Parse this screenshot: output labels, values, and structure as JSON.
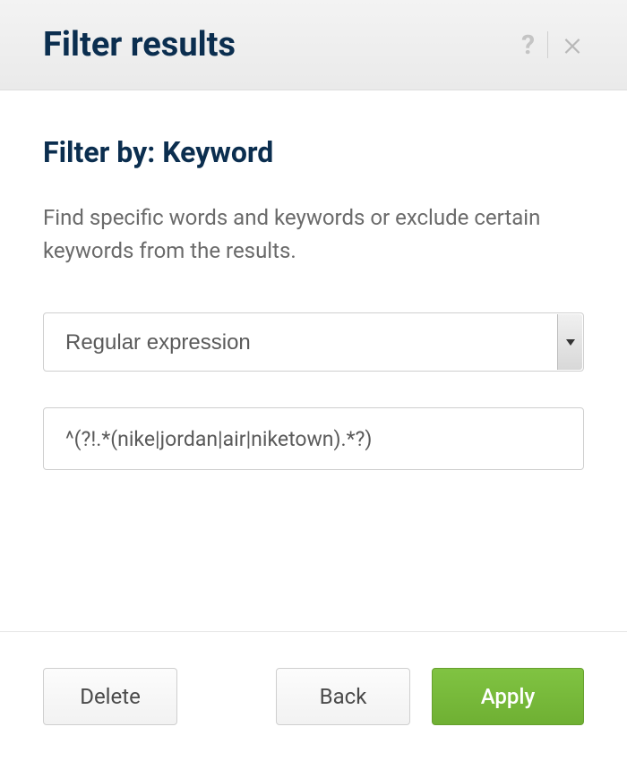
{
  "header": {
    "title": "Filter results"
  },
  "content": {
    "subtitle_prefix": "Filter by: ",
    "subtitle_value": "Keyword",
    "description": "Find specific words and keywords or exclude certain keywords from the results.",
    "filter_type": {
      "selected": "Regular expression"
    },
    "expression": {
      "value": "^(?!.*(nike|jordan|air|niketown).*?)"
    }
  },
  "footer": {
    "delete_label": "Delete",
    "back_label": "Back",
    "apply_label": "Apply"
  }
}
